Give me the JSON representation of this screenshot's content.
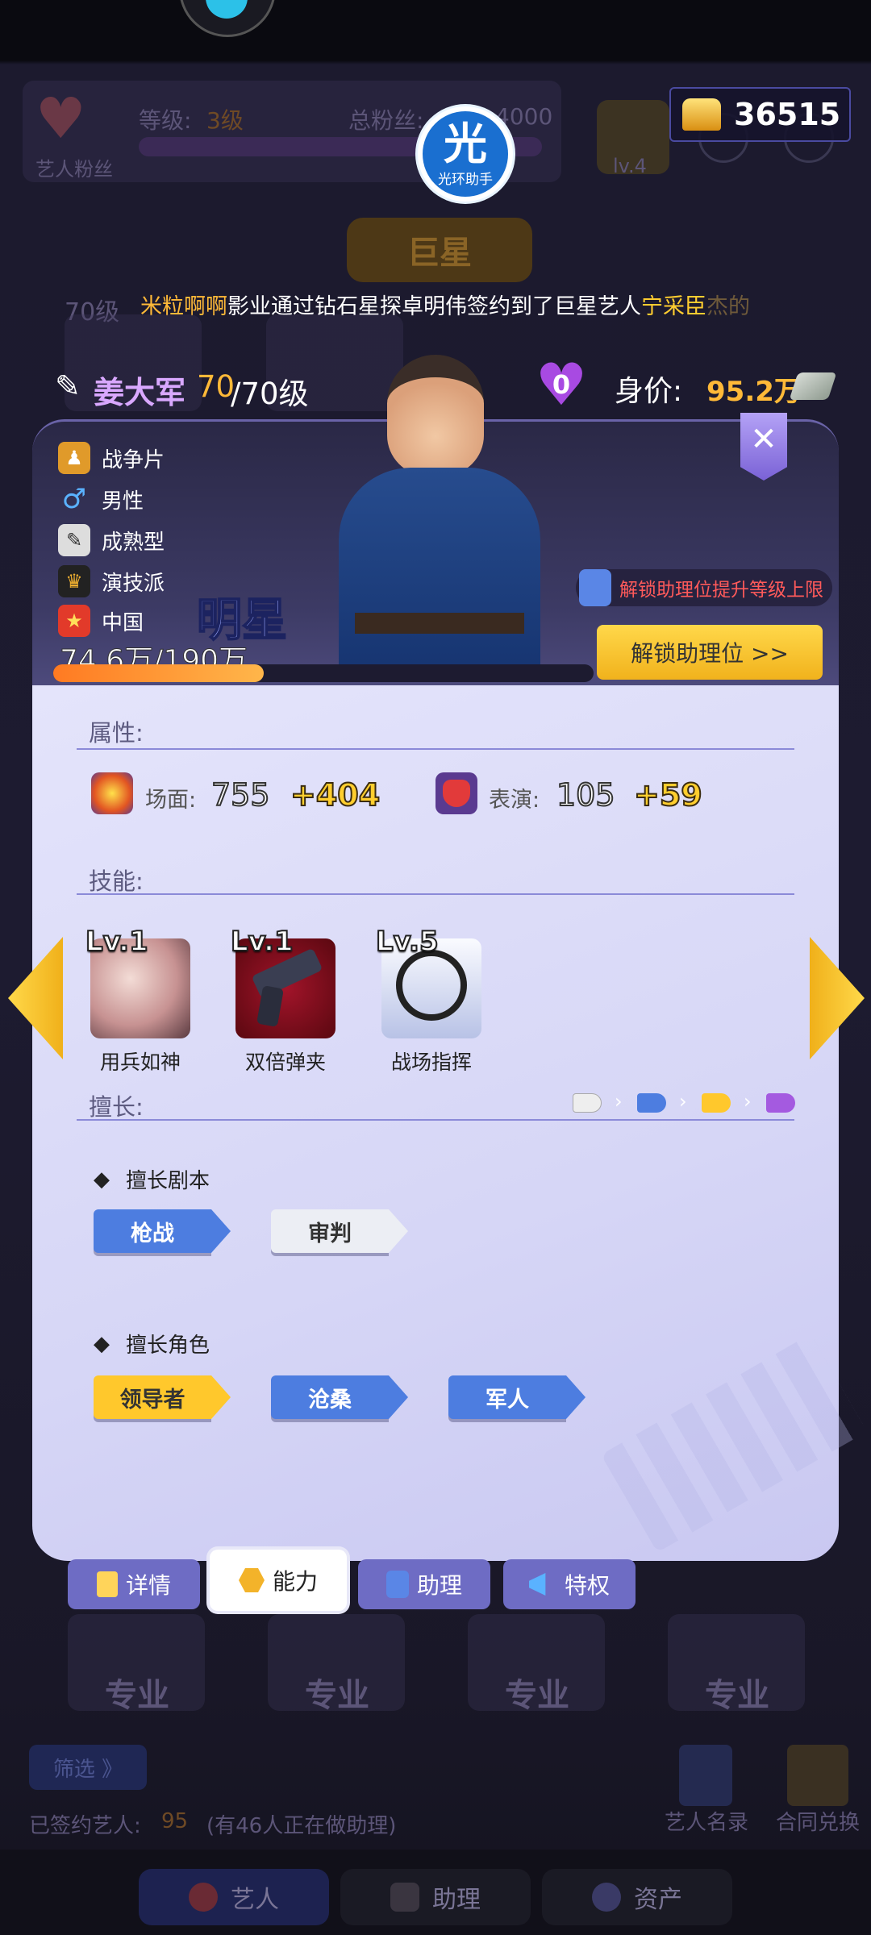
{
  "header": {
    "fan_label": "艺人粉丝",
    "level_label": "等级:",
    "level_value": "3级",
    "total_fans_label": "总粉丝:",
    "total_fans_value": "4000",
    "assistant_badge_char": "光",
    "assistant_badge_text": "光环助手",
    "studio_level": "lv.4",
    "gold_amount": "36515",
    "rank_banner": "巨星"
  },
  "ticker": {
    "part1": "米粒啊啊",
    "part2": "影业通过钻石星探卓明伟签约到了巨星艺人",
    "part3": "宁采臣",
    "part4": "杰的",
    "level_hint": "70级"
  },
  "artist": {
    "name": "姜大军",
    "level_current": "70",
    "level_max": "/70级",
    "heart_count": "0",
    "worth_label": "身价:",
    "worth_value": "95.2万",
    "tags": [
      {
        "icon": "war-film-icon",
        "label": "战争片"
      },
      {
        "icon": "male-icon",
        "label": "男性"
      },
      {
        "icon": "mature-type-icon",
        "label": "成熟型"
      },
      {
        "icon": "acting-school-icon",
        "label": "演技派"
      },
      {
        "icon": "china-flag-icon",
        "label": "中国"
      }
    ],
    "rank": "明星",
    "exp_text": "74.6万/190万",
    "exp_progress": 0.39,
    "unlock_hint": "解锁助理位提升等级上限",
    "unlock_button": "解锁助理位 >>"
  },
  "attributes": {
    "title": "属性:",
    "items": [
      {
        "icon": "scene-icon",
        "label": "场面:",
        "value": "755",
        "bonus": "+404"
      },
      {
        "icon": "performance-icon",
        "label": "表演:",
        "value": "105",
        "bonus": "+59"
      }
    ]
  },
  "skills": {
    "title": "技能:",
    "items": [
      {
        "level": "Lv.1",
        "name": "用兵如神",
        "icon": "tank-skill-icon"
      },
      {
        "level": "Lv.1",
        "name": "双倍弹夹",
        "icon": "revolver-skill-icon"
      },
      {
        "level": "Lv.5",
        "name": "战场指挥",
        "icon": "ring-skill-icon"
      }
    ]
  },
  "specialty": {
    "title": "擅长:",
    "scripts_title": "擅长剧本",
    "scripts": [
      {
        "label": "枪战",
        "color": "blue"
      },
      {
        "label": "审判",
        "color": "white"
      }
    ],
    "roles_title": "擅长角色",
    "roles": [
      {
        "label": "领导者",
        "color": "yellow"
      },
      {
        "label": "沧桑",
        "color": "blue"
      },
      {
        "label": "军人",
        "color": "blue"
      }
    ],
    "tier_colors": [
      "#eeeeee",
      "#4d7de0",
      "#ffc82c",
      "#a45ae0"
    ]
  },
  "tabs": [
    {
      "label": "详情",
      "icon": "detail-icon"
    },
    {
      "label": "能力",
      "icon": "ability-icon"
    },
    {
      "label": "助理",
      "icon": "assistant-icon"
    },
    {
      "label": "特权",
      "icon": "privilege-icon"
    }
  ],
  "background_list": {
    "card_label": "专业",
    "filter": "筛选 》",
    "signed_label": "已签约艺人:",
    "signed_count": "95",
    "assisting_note": "(有46人正在做助理)",
    "catalog": "艺人名录",
    "contract": "合同兑换"
  },
  "bottom_nav": [
    {
      "label": "艺人",
      "icon": "artist-icon"
    },
    {
      "label": "助理",
      "icon": "assistant-nav-icon"
    },
    {
      "label": "资产",
      "icon": "asset-icon"
    }
  ],
  "colors": {
    "accent_gold": "#ffb938",
    "panel_bg": "#d9d9f6",
    "artist_name": "#d9a8ff"
  }
}
